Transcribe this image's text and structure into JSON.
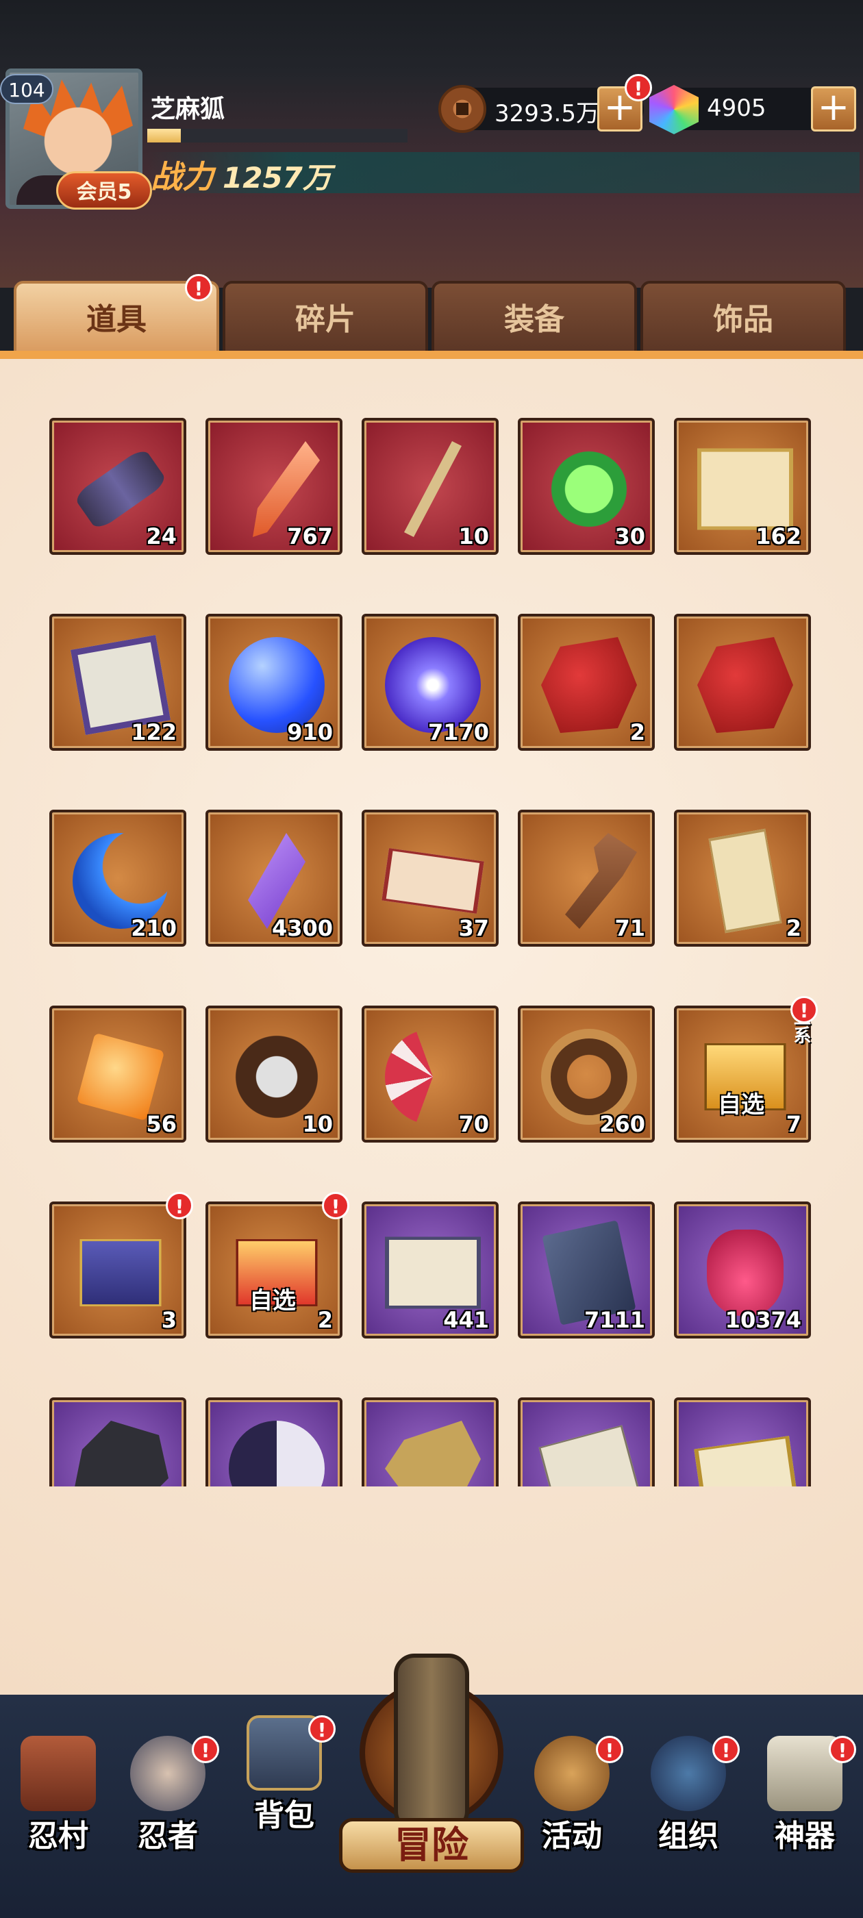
{
  "player": {
    "level": "104",
    "name": "芝麻狐",
    "vip": "会员5",
    "power_label": "战力",
    "power_value": "1257万",
    "exp_progress": 0.13
  },
  "currency": {
    "copper": "3293.5万",
    "gems": "4905",
    "plus": "+"
  },
  "badge": "!",
  "tabs": [
    "道具",
    "碎片",
    "装备",
    "饰品"
  ],
  "items": [
    {
      "icon": "scroll-icon",
      "count": "24",
      "frame": "red"
    },
    {
      "icon": "feather-icon",
      "count": "767",
      "frame": "red"
    },
    {
      "icon": "stick-icon",
      "count": "10",
      "frame": "red"
    },
    {
      "icon": "amulet-icon",
      "count": "30",
      "frame": "red"
    },
    {
      "icon": "paper-scroll-icon",
      "count": "162",
      "frame": "orange"
    },
    {
      "icon": "cloth-icon",
      "count": "122",
      "frame": "orange"
    },
    {
      "icon": "blue-orb-icon",
      "count": "910",
      "frame": "orange"
    },
    {
      "icon": "purple-orb-icon",
      "count": "7170",
      "frame": "orange"
    },
    {
      "icon": "red-rock-icon",
      "count": "2",
      "frame": "orange"
    },
    {
      "icon": "red-target-rock-icon",
      "count": "",
      "frame": "orange"
    },
    {
      "icon": "moon-icon",
      "count": "210",
      "frame": "orange"
    },
    {
      "icon": "crystal-icon",
      "count": "4300",
      "frame": "orange"
    },
    {
      "icon": "fortune-banner-icon",
      "count": "37",
      "frame": "orange"
    },
    {
      "icon": "key-icon",
      "count": "71",
      "frame": "orange"
    },
    {
      "icon": "talisman-icon",
      "count": "2",
      "frame": "orange"
    },
    {
      "icon": "orange-gem-icon",
      "count": "56",
      "frame": "orange"
    },
    {
      "icon": "shuriken-icon",
      "count": "10",
      "frame": "orange"
    },
    {
      "icon": "fan-icon",
      "count": "70",
      "frame": "orange"
    },
    {
      "icon": "rope-icon",
      "count": "260",
      "frame": "orange"
    },
    {
      "icon": "gift-box-icon",
      "count": "7",
      "frame": "orange",
      "sub": "自选",
      "side": "三系",
      "alert": true
    },
    {
      "icon": "blue-chest-icon",
      "count": "3",
      "frame": "orange",
      "alert": true
    },
    {
      "icon": "red-chest-icon",
      "count": "2",
      "frame": "orange",
      "sub": "自选",
      "alert": true
    },
    {
      "icon": "white-scroll-icon",
      "count": "441",
      "frame": "purple"
    },
    {
      "icon": "book-icon",
      "count": "7111",
      "frame": "purple"
    },
    {
      "icon": "jar-icon",
      "count": "10374",
      "frame": "purple"
    },
    {
      "icon": "ore-icon",
      "count": "",
      "frame": "purple"
    },
    {
      "icon": "yin-yang-icon",
      "count": "",
      "frame": "purple"
    },
    {
      "icon": "bone-icon",
      "count": "",
      "frame": "purple"
    },
    {
      "icon": "papers-icon",
      "count": "",
      "frame": "purple"
    },
    {
      "icon": "gold-banner-icon",
      "count": "",
      "frame": "purple"
    }
  ],
  "nav": {
    "village": "忍村",
    "ninja": "忍者",
    "bag": "背包",
    "adventure": "冒险",
    "activity": "活动",
    "organization": "组织",
    "artifact": "神器"
  }
}
